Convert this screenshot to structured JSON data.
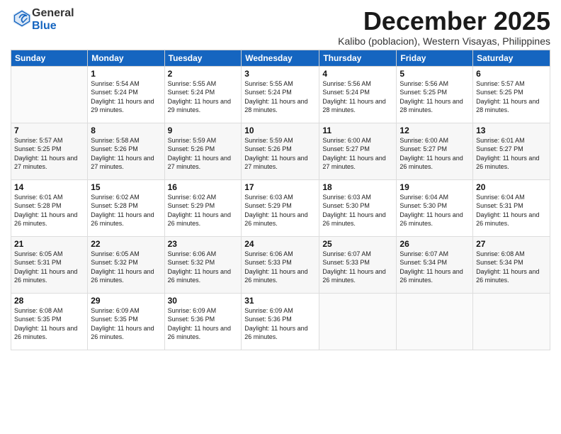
{
  "logo": {
    "general": "General",
    "blue": "Blue"
  },
  "header": {
    "month_year": "December 2025",
    "location": "Kalibo (poblacion), Western Visayas, Philippines"
  },
  "weekdays": [
    "Sunday",
    "Monday",
    "Tuesday",
    "Wednesday",
    "Thursday",
    "Friday",
    "Saturday"
  ],
  "weeks": [
    [
      {
        "day": "",
        "info": ""
      },
      {
        "day": "1",
        "info": "Sunrise: 5:54 AM\nSunset: 5:24 PM\nDaylight: 11 hours\nand 29 minutes."
      },
      {
        "day": "2",
        "info": "Sunrise: 5:55 AM\nSunset: 5:24 PM\nDaylight: 11 hours\nand 29 minutes."
      },
      {
        "day": "3",
        "info": "Sunrise: 5:55 AM\nSunset: 5:24 PM\nDaylight: 11 hours\nand 28 minutes."
      },
      {
        "day": "4",
        "info": "Sunrise: 5:56 AM\nSunset: 5:24 PM\nDaylight: 11 hours\nand 28 minutes."
      },
      {
        "day": "5",
        "info": "Sunrise: 5:56 AM\nSunset: 5:25 PM\nDaylight: 11 hours\nand 28 minutes."
      },
      {
        "day": "6",
        "info": "Sunrise: 5:57 AM\nSunset: 5:25 PM\nDaylight: 11 hours\nand 28 minutes."
      }
    ],
    [
      {
        "day": "7",
        "info": "Sunrise: 5:57 AM\nSunset: 5:25 PM\nDaylight: 11 hours\nand 27 minutes."
      },
      {
        "day": "8",
        "info": "Sunrise: 5:58 AM\nSunset: 5:26 PM\nDaylight: 11 hours\nand 27 minutes."
      },
      {
        "day": "9",
        "info": "Sunrise: 5:59 AM\nSunset: 5:26 PM\nDaylight: 11 hours\nand 27 minutes."
      },
      {
        "day": "10",
        "info": "Sunrise: 5:59 AM\nSunset: 5:26 PM\nDaylight: 11 hours\nand 27 minutes."
      },
      {
        "day": "11",
        "info": "Sunrise: 6:00 AM\nSunset: 5:27 PM\nDaylight: 11 hours\nand 27 minutes."
      },
      {
        "day": "12",
        "info": "Sunrise: 6:00 AM\nSunset: 5:27 PM\nDaylight: 11 hours\nand 26 minutes."
      },
      {
        "day": "13",
        "info": "Sunrise: 6:01 AM\nSunset: 5:27 PM\nDaylight: 11 hours\nand 26 minutes."
      }
    ],
    [
      {
        "day": "14",
        "info": "Sunrise: 6:01 AM\nSunset: 5:28 PM\nDaylight: 11 hours\nand 26 minutes."
      },
      {
        "day": "15",
        "info": "Sunrise: 6:02 AM\nSunset: 5:28 PM\nDaylight: 11 hours\nand 26 minutes."
      },
      {
        "day": "16",
        "info": "Sunrise: 6:02 AM\nSunset: 5:29 PM\nDaylight: 11 hours\nand 26 minutes."
      },
      {
        "day": "17",
        "info": "Sunrise: 6:03 AM\nSunset: 5:29 PM\nDaylight: 11 hours\nand 26 minutes."
      },
      {
        "day": "18",
        "info": "Sunrise: 6:03 AM\nSunset: 5:30 PM\nDaylight: 11 hours\nand 26 minutes."
      },
      {
        "day": "19",
        "info": "Sunrise: 6:04 AM\nSunset: 5:30 PM\nDaylight: 11 hours\nand 26 minutes."
      },
      {
        "day": "20",
        "info": "Sunrise: 6:04 AM\nSunset: 5:31 PM\nDaylight: 11 hours\nand 26 minutes."
      }
    ],
    [
      {
        "day": "21",
        "info": "Sunrise: 6:05 AM\nSunset: 5:31 PM\nDaylight: 11 hours\nand 26 minutes."
      },
      {
        "day": "22",
        "info": "Sunrise: 6:05 AM\nSunset: 5:32 PM\nDaylight: 11 hours\nand 26 minutes."
      },
      {
        "day": "23",
        "info": "Sunrise: 6:06 AM\nSunset: 5:32 PM\nDaylight: 11 hours\nand 26 minutes."
      },
      {
        "day": "24",
        "info": "Sunrise: 6:06 AM\nSunset: 5:33 PM\nDaylight: 11 hours\nand 26 minutes."
      },
      {
        "day": "25",
        "info": "Sunrise: 6:07 AM\nSunset: 5:33 PM\nDaylight: 11 hours\nand 26 minutes."
      },
      {
        "day": "26",
        "info": "Sunrise: 6:07 AM\nSunset: 5:34 PM\nDaylight: 11 hours\nand 26 minutes."
      },
      {
        "day": "27",
        "info": "Sunrise: 6:08 AM\nSunset: 5:34 PM\nDaylight: 11 hours\nand 26 minutes."
      }
    ],
    [
      {
        "day": "28",
        "info": "Sunrise: 6:08 AM\nSunset: 5:35 PM\nDaylight: 11 hours\nand 26 minutes."
      },
      {
        "day": "29",
        "info": "Sunrise: 6:09 AM\nSunset: 5:35 PM\nDaylight: 11 hours\nand 26 minutes."
      },
      {
        "day": "30",
        "info": "Sunrise: 6:09 AM\nSunset: 5:36 PM\nDaylight: 11 hours\nand 26 minutes."
      },
      {
        "day": "31",
        "info": "Sunrise: 6:09 AM\nSunset: 5:36 PM\nDaylight: 11 hours\nand 26 minutes."
      },
      {
        "day": "",
        "info": ""
      },
      {
        "day": "",
        "info": ""
      },
      {
        "day": "",
        "info": ""
      }
    ]
  ]
}
